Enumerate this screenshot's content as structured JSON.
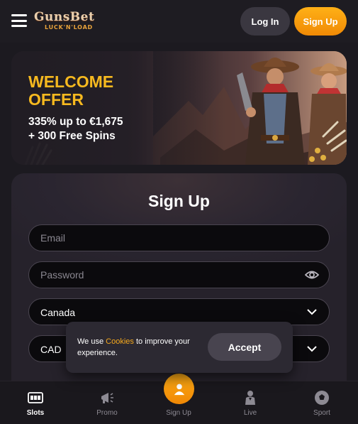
{
  "header": {
    "logo_main": "GunsBet",
    "logo_sub": "LUCK'N'LOAD",
    "login_label": "Log In",
    "signup_label": "Sign Up"
  },
  "banner": {
    "title_line1": "WELCOME",
    "title_line2": "OFFER",
    "bonus_line1": "335% up to €1,675",
    "bonus_line2": "+ 300 Free Spins"
  },
  "form": {
    "title": "Sign Up",
    "email_placeholder": "Email",
    "password_placeholder": "Password",
    "country_value": "Canada",
    "currency_value": "CAD"
  },
  "cookie": {
    "text_before": "We use ",
    "link_text": "Cookies",
    "text_after": " to improve your experience.",
    "accept_label": "Accept"
  },
  "nav": {
    "items": [
      {
        "label": "Slots",
        "icon": "slots-icon"
      },
      {
        "label": "Promo",
        "icon": "megaphone-icon"
      },
      {
        "label": "Sign Up",
        "icon": "user-icon"
      },
      {
        "label": "Live",
        "icon": "live-dealer-icon"
      },
      {
        "label": "Sport",
        "icon": "soccer-ball-icon"
      }
    ]
  },
  "colors": {
    "accent_orange": "#f6a91d",
    "banner_title": "#f6b91f",
    "background": "#1c1a20"
  }
}
